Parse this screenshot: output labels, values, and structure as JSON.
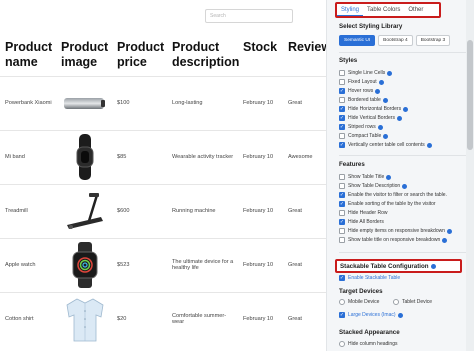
{
  "search": {
    "placeholder": "Search"
  },
  "table": {
    "headers": [
      "Product name",
      "Product image",
      "Product price",
      "Product description",
      "Stock",
      "Review"
    ],
    "rows": [
      {
        "name": "Powerbank Xiaomi",
        "image": "powerbank",
        "price": "$100",
        "description": "Long-lasting",
        "stock": "February 10",
        "review": "Great"
      },
      {
        "name": "Mi band",
        "image": "fitness-band",
        "price": "$85",
        "description": "Wearable activity tracker",
        "stock": "February 10",
        "review": "Awesome"
      },
      {
        "name": "Treadmill",
        "image": "treadmill",
        "price": "$600",
        "description": "Running machine",
        "stock": "February 10",
        "review": "Great"
      },
      {
        "name": "Apple watch",
        "image": "smartwatch",
        "price": "$523",
        "description": "The ultimate device for a healthy life",
        "stock": "February 10",
        "review": "Great"
      },
      {
        "name": "Cotton shirt",
        "image": "shirt",
        "price": "$20",
        "description": "Comfortable summer-wear",
        "stock": "February 10",
        "review": "Great"
      }
    ]
  },
  "panel": {
    "tabs": [
      "Styling",
      "Table Colors",
      "Other"
    ],
    "active_tab": "Styling",
    "library_title": "Select Styling Library",
    "libraries": [
      "Semantic UI",
      "Bootstrap 4",
      "Bootstrap 3"
    ],
    "active_library": "Semantic UI",
    "styles_title": "Styles",
    "styles": [
      {
        "label": "Single Line Cells",
        "checked": false,
        "info": true
      },
      {
        "label": "Fixed Layout",
        "checked": false,
        "info": true
      },
      {
        "label": "Hover rows",
        "checked": true,
        "info": true
      },
      {
        "label": "Bordered table",
        "checked": false,
        "info": true
      },
      {
        "label": "Hide Horizontal Borders",
        "checked": true,
        "info": true
      },
      {
        "label": "Hide Vertical Borders",
        "checked": true,
        "info": true
      },
      {
        "label": "Striped rows",
        "checked": true,
        "info": true
      },
      {
        "label": "Compact Table",
        "checked": false,
        "info": true
      },
      {
        "label": "Vertically center table cell contents",
        "checked": true,
        "info": true
      }
    ],
    "features_title": "Features",
    "features": [
      {
        "label": "Show Table Title",
        "checked": false,
        "info": true
      },
      {
        "label": "Show Table Description",
        "checked": false,
        "info": true
      },
      {
        "label": "Enable the visitor to filter or search the table.",
        "checked": true,
        "info": false
      },
      {
        "label": "Enable sorting of the table by the visitor",
        "checked": true,
        "info": false
      },
      {
        "label": "Hide Header Row",
        "checked": false,
        "info": false
      },
      {
        "label": "Hide All Borders",
        "checked": true,
        "info": false
      },
      {
        "label": "Hide empty items on responsive breakdown",
        "checked": false,
        "info": true
      },
      {
        "label": "Show table title on responsive breakdown",
        "checked": false,
        "info": true
      }
    ],
    "stackable_title": "Stackable Table Configuration",
    "enable_stackable": {
      "label": "Enable Stackable Table",
      "checked": true
    },
    "target_devices_title": "Target Devices",
    "devices": [
      {
        "label": "Mobile Device",
        "checked": false
      },
      {
        "label": "Tablet Device",
        "checked": false
      },
      {
        "label": "Large Devices (Imac)",
        "checked": true
      }
    ],
    "stacked_title": "Stacked Appearance",
    "stacked_options": [
      {
        "label": "Hide column headings",
        "checked": false
      }
    ]
  },
  "colors": {
    "accent": "#2a6fd6",
    "highlight": "#c91c1c"
  }
}
